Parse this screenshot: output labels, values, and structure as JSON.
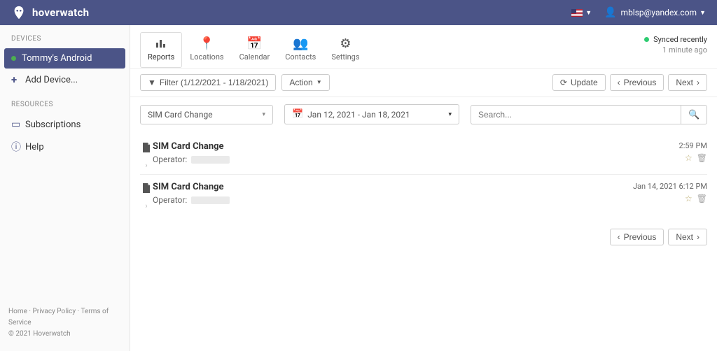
{
  "brand": {
    "name": "hoverwatch"
  },
  "topbar": {
    "account_email": "mblsp@yandex.com"
  },
  "sidebar": {
    "section_devices": "DEVICES",
    "active_device": "Tommy's Android",
    "add_device": "Add Device...",
    "section_resources": "RESOURCES",
    "subscriptions": "Subscriptions",
    "help": "Help"
  },
  "tabs": {
    "reports": "Reports",
    "locations": "Locations",
    "calendar": "Calendar",
    "contacts": "Contacts",
    "settings": "Settings"
  },
  "sync": {
    "status": "Synced recently",
    "ago": "1 minute ago"
  },
  "filterbar": {
    "filter_label": "Filter (1/12/2021 - 1/18/2021)",
    "action_label": "Action",
    "update": "Update",
    "previous": "Previous",
    "next": "Next"
  },
  "controls": {
    "report_type": "SIM Card Change",
    "date_range": "Jan 12, 2021 - Jan 18, 2021",
    "search_placeholder": "Search..."
  },
  "records": [
    {
      "title": "SIM Card Change",
      "operator_label": "Operator:",
      "time": "2:59 PM"
    },
    {
      "title": "SIM Card Change",
      "operator_label": "Operator:",
      "time": "Jan 14, 2021 6:12 PM"
    }
  ],
  "pager": {
    "previous": "Previous",
    "next": "Next"
  },
  "footer": {
    "home": "Home",
    "privacy": "Privacy Policy",
    "terms": "Terms of Service",
    "copyright": "© 2021 Hoverwatch"
  }
}
